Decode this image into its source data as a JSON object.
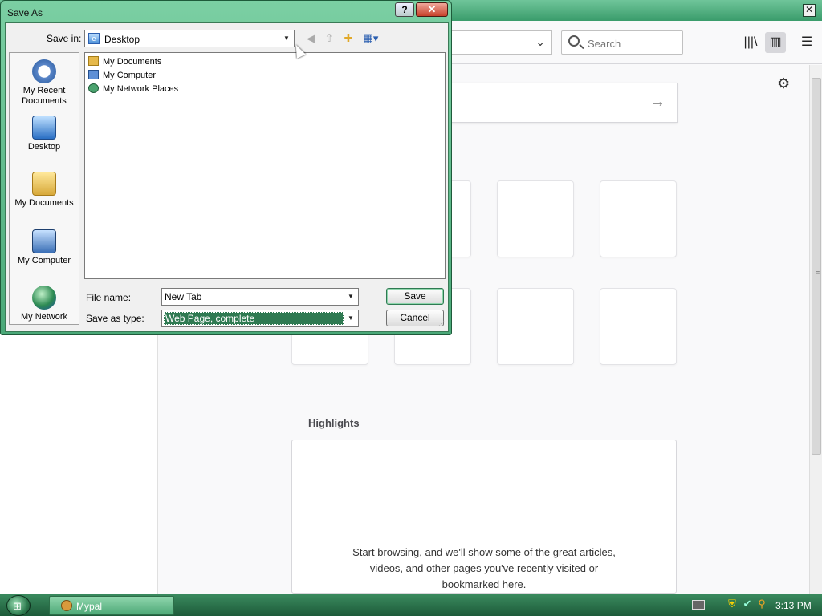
{
  "dialog": {
    "title": "Save As",
    "help_label": "?",
    "close_label": "✕",
    "save_in": {
      "label": "Save in:",
      "value": "Desktop"
    },
    "places": [
      {
        "label_line1": "My Recent",
        "label_line2": "Documents"
      },
      {
        "label_line1": "Desktop",
        "label_line2": ""
      },
      {
        "label_line1": "My Documents",
        "label_line2": ""
      },
      {
        "label_line1": "My Computer",
        "label_line2": ""
      },
      {
        "label_line1": "My Network",
        "label_line2": ""
      }
    ],
    "files": [
      {
        "name": "My Documents",
        "icon": "folder-icon"
      },
      {
        "name": "My Computer",
        "icon": "computer-icon"
      },
      {
        "name": "My Network Places",
        "icon": "network-icon"
      }
    ],
    "file_name": {
      "label": "File name:",
      "value": "New Tab"
    },
    "save_as_type": {
      "label": "Save as type:",
      "value": "Web Page, complete"
    },
    "buttons": {
      "save": "Save",
      "cancel": "Cancel"
    }
  },
  "browser": {
    "search_placeholder": "Search",
    "highlights": {
      "title": "Highlights",
      "message": "Start browsing, and we'll show some of the great articles, videos, and other pages you've recently visited or bookmarked here."
    }
  },
  "taskbar": {
    "app_label": "Mypal",
    "clock": "3:13 PM"
  },
  "colors": {
    "theme_green": "#4aa878",
    "selection": "#2f7a52",
    "firefox_orange": "#ff4f00"
  }
}
